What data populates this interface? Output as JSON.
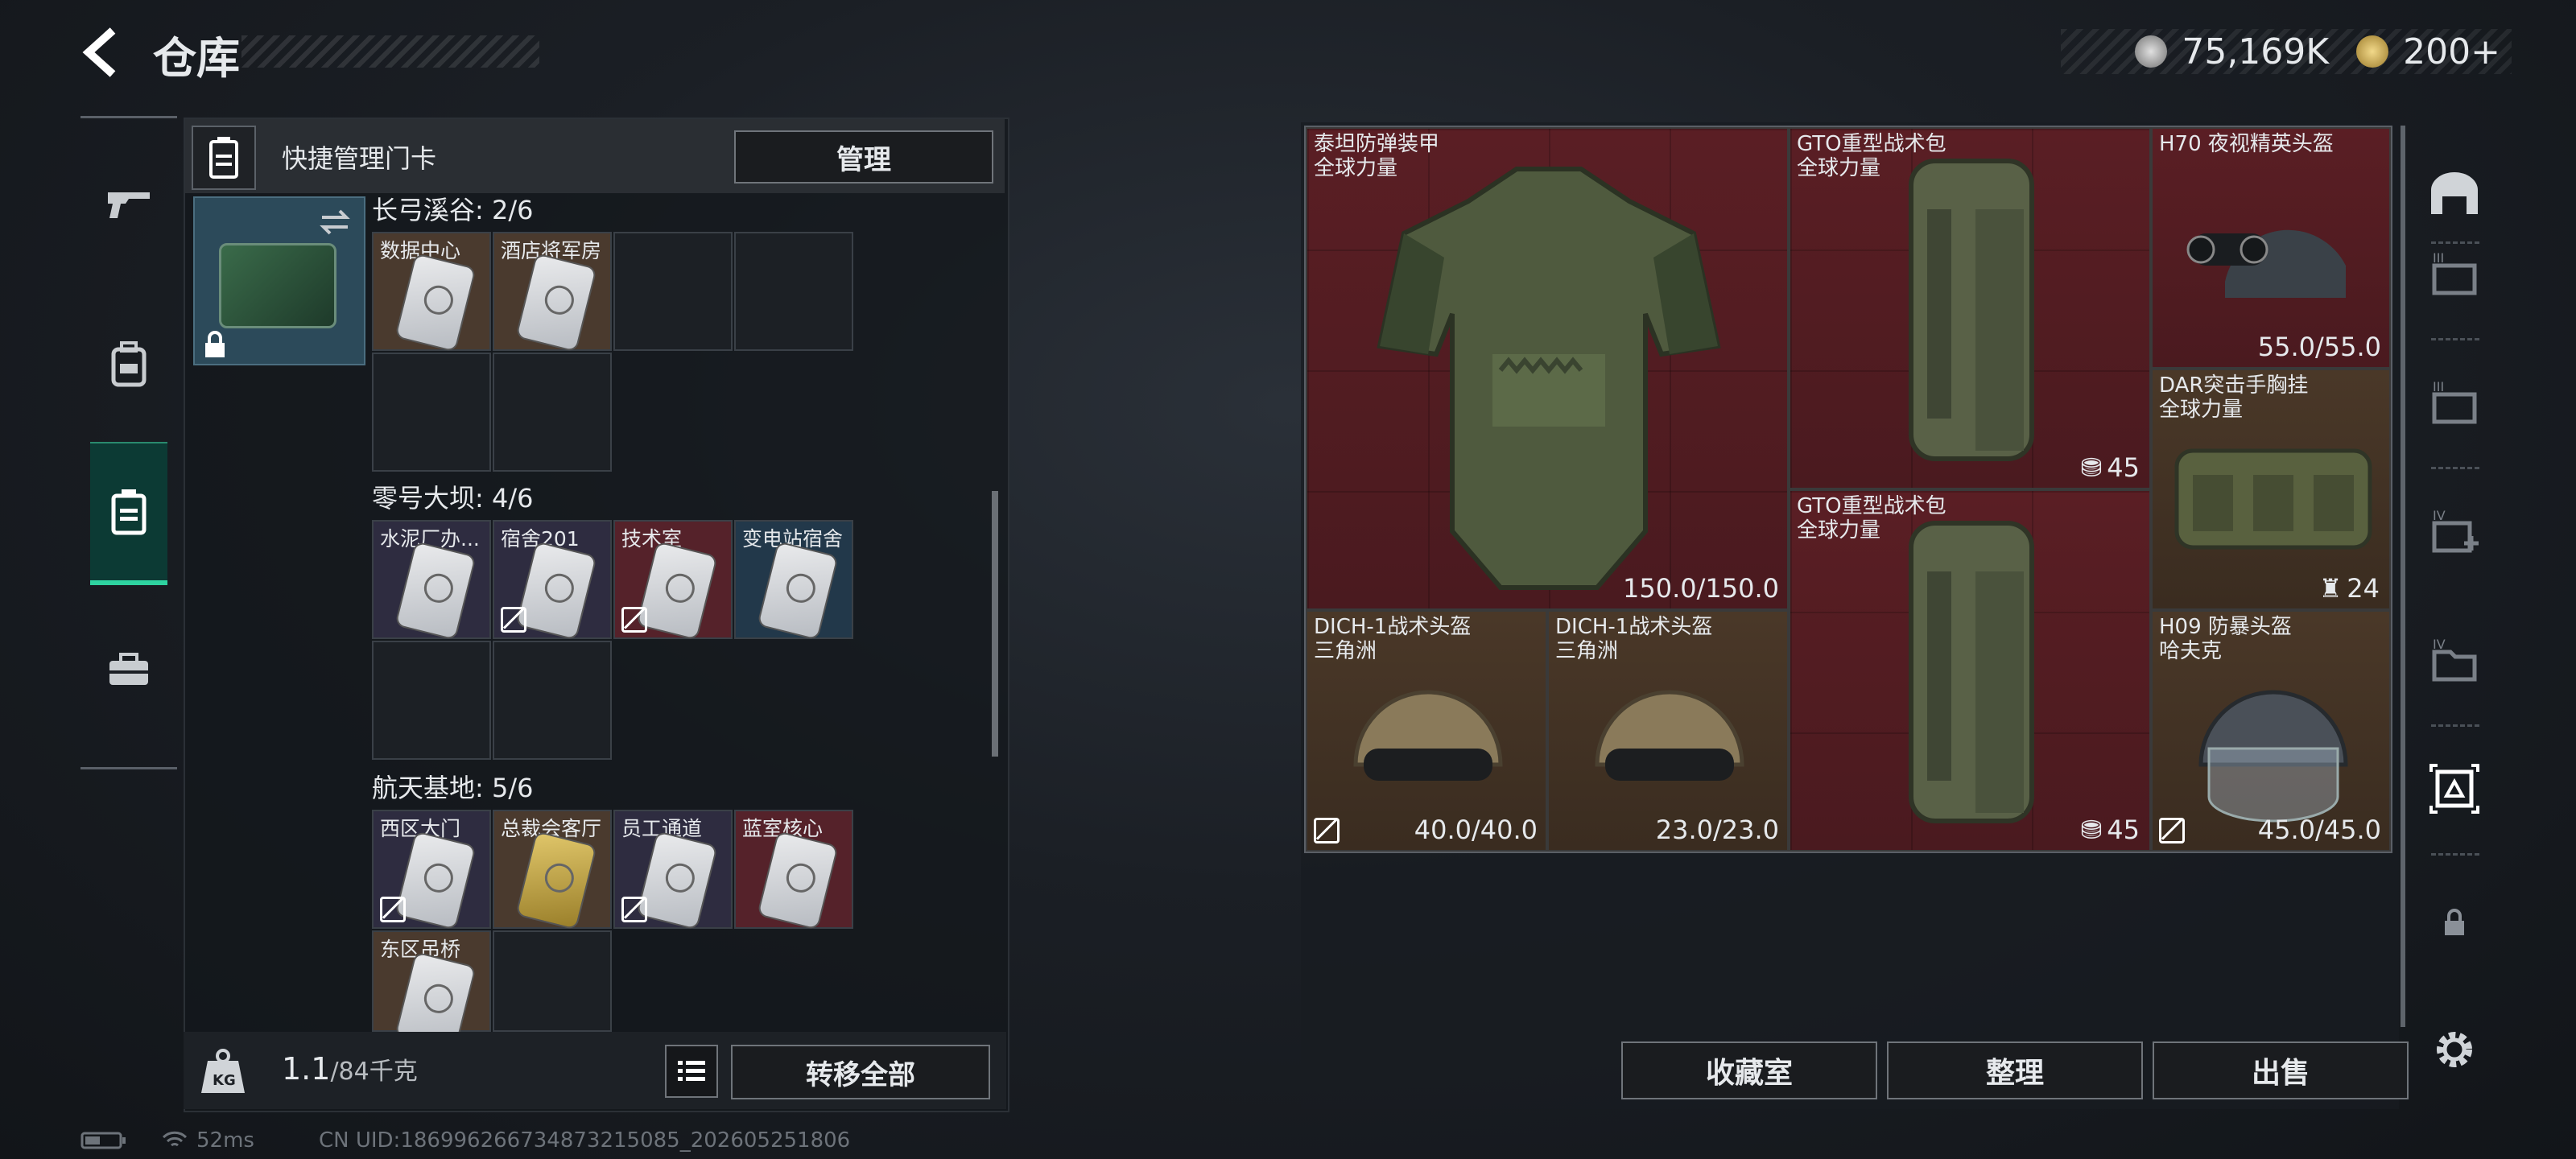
{
  "header": {
    "title": "仓库",
    "currency_silver": "75,169K",
    "currency_gold": "200+"
  },
  "left_nav": {
    "items": [
      "gun-icon",
      "backpack-icon",
      "keycard-case-icon",
      "toolbox-icon"
    ],
    "active": 2
  },
  "keycard_panel": {
    "quick_label": "快捷管理门卡",
    "manage_button": "管理",
    "groups": [
      {
        "title": "长弓溪谷: 2/6",
        "cards": [
          "数据中心",
          "酒店将军房"
        ]
      },
      {
        "title": "零号大坝: 4/6",
        "cards": [
          "水泥厂办...",
          "宿舍201",
          "技术室",
          "变电站宿舍"
        ]
      },
      {
        "title": "航天基地: 5/6",
        "cards": [
          "西区大门",
          "总裁会客厅",
          "员工通道",
          "蓝室核心",
          "东区吊桥"
        ]
      }
    ],
    "weight_value": "1.1",
    "weight_capacity": "/84千克",
    "transfer_button": "转移全部"
  },
  "status": {
    "ping": "52ms",
    "uid": "CN UID:1869962667348732150​85_202605251806"
  },
  "stash": {
    "items": [
      {
        "name": "泰坦防弹装甲",
        "sub": "全球力量",
        "value": "150.0/150.0"
      },
      {
        "name": "GTO重型战术包",
        "sub": "全球力量",
        "badge": "45"
      },
      {
        "name": "H70 夜视精英头盔",
        "sub": "",
        "value": "55.0/55.0"
      },
      {
        "name": "DAR突击手胸挂",
        "sub": "全球力量",
        "badge": "24"
      },
      {
        "name": "GTO重型战术包",
        "sub": "全球力量",
        "badge": "45"
      },
      {
        "name": "DICH-1战术头盔",
        "sub": "三角洲",
        "value": "40.0/40.0"
      },
      {
        "name": "DICH-1战术头盔",
        "sub": "三角洲",
        "value": "23.0/23.0"
      },
      {
        "name": "H09 防暴头盔",
        "sub": "哈夫克",
        "value": "45.0/45.0"
      }
    ],
    "buttons": {
      "collection": "收藏室",
      "sort": "整理",
      "sell": "出售"
    }
  },
  "colors": {
    "accent": "#2ed3a0",
    "red_rarity": "#5a1e24",
    "brown_rarity": "#4a3828"
  }
}
